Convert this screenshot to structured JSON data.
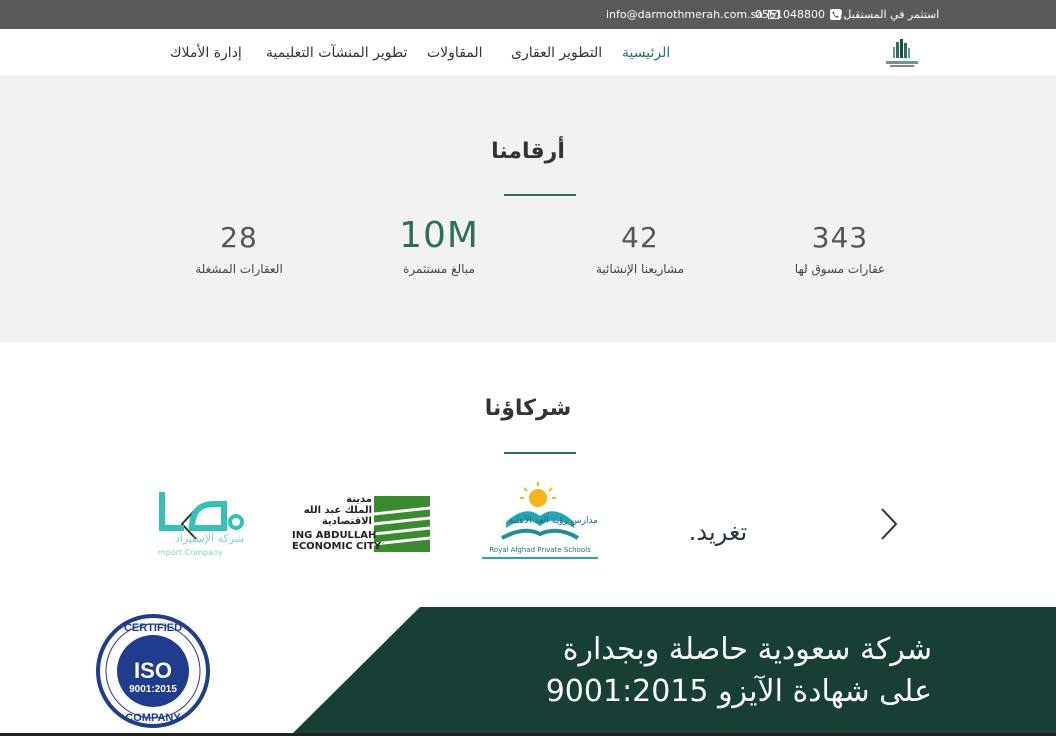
{
  "topbar": {
    "email": "info@darmothmerah.com.sa",
    "phone": "0561048800",
    "tagline": "استثمر في المستقبل!"
  },
  "nav": {
    "items": [
      {
        "label": "الرئيسية",
        "active": true
      },
      {
        "label": "التطوير العقارى"
      },
      {
        "label": "المقاولات"
      },
      {
        "label": "تطوير المنشآت التعليمية"
      },
      {
        "label": "إدارة الأملاك"
      }
    ]
  },
  "stats": {
    "title": "أرقامنا",
    "items": [
      {
        "value": "343",
        "label": "عقارات مسوق لها"
      },
      {
        "value": "42",
        "label": "مشاريعنا الإنشائية"
      },
      {
        "value": "10M",
        "label": "مبالغ مستثمرة"
      },
      {
        "value": "28",
        "label": "العقارات المشغلة"
      }
    ]
  },
  "partners": {
    "title": "شركاؤنا",
    "logos": [
      {
        "name": "تغريد."
      },
      {
        "name": "مدارس رؤية الغد الأهلية",
        "sub": "Royal Alghad Private Schools"
      },
      {
        "name_ar_1": "مدينة",
        "name_ar_2": "الملك عبد الله",
        "name_ar_3": "الاقتصادية",
        "name_en_1": "ING ABDULLAH",
        "name_en_2": "ECONOMIC CITY"
      },
      {
        "name": "شركة الإستيراد",
        "sub": "mport Company"
      }
    ]
  },
  "banner": {
    "line1": "شركة سعودية حاصلة وبجدارة",
    "line2": "على شهادة الآيزو 9001:2015",
    "badge_top": "CERTIFIED",
    "badge_mid": "ISO",
    "badge_num": "9001:2015",
    "badge_bottom": "COMPANY"
  },
  "colors": {
    "topbar": "#5a5a5a",
    "accent": "#2e6e5c",
    "banner": "#173f36",
    "iso_blue": "#1f3c8f"
  }
}
